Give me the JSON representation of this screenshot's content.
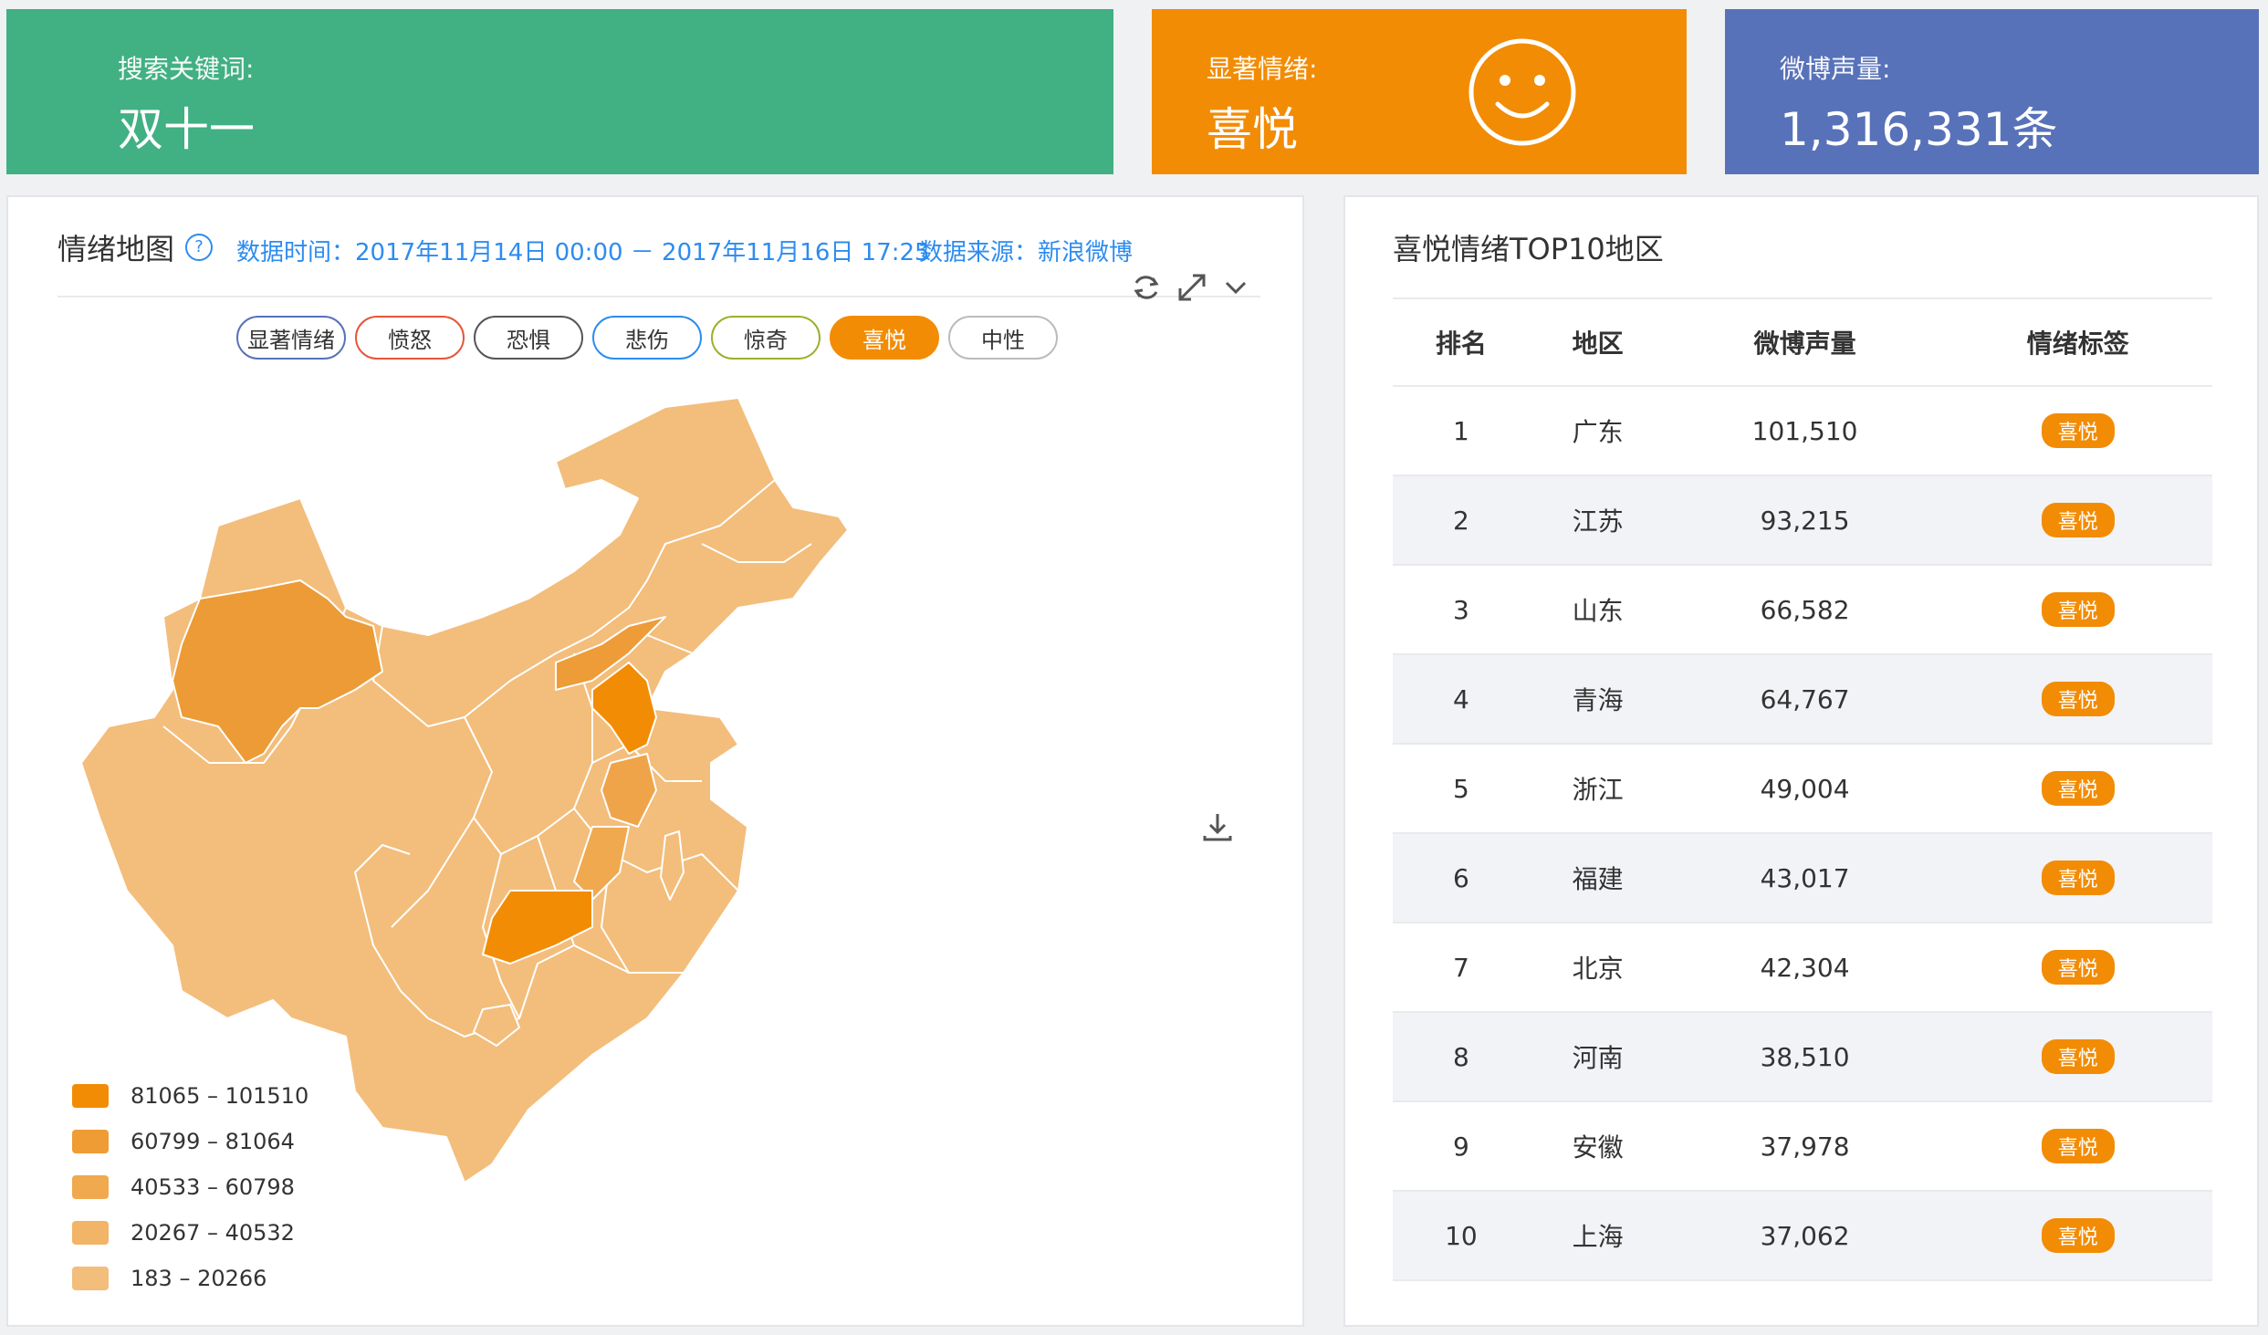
{
  "header": {
    "keyword": {
      "label": "搜索关键词:",
      "value": "双十一"
    },
    "emotion": {
      "label": "显著情绪:",
      "value": "喜悦",
      "icon": "smiley-icon"
    },
    "volume": {
      "label": "微博声量:",
      "value": "1,316,331条"
    }
  },
  "map_panel": {
    "title": "情绪地图",
    "help_icon": "?",
    "data_time": "数据时间：2017年11月14日 00:00 － 2017年11月16日 17:25",
    "data_source": "数据来源：新浪微博",
    "chips": [
      {
        "label": "显著情绪",
        "color": "#5872b9"
      },
      {
        "label": "愤怒",
        "color": "#e8543a"
      },
      {
        "label": "恐惧",
        "color": "#555555"
      },
      {
        "label": "悲伤",
        "color": "#2d8cf0"
      },
      {
        "label": "惊奇",
        "color": "#9bb02b"
      },
      {
        "label": "喜悦",
        "color": "#f28c05",
        "active": true
      },
      {
        "label": "中性",
        "color": "#bbbbbb"
      }
    ],
    "legend": [
      {
        "range": "81065 – 101510",
        "color": "#f28c05"
      },
      {
        "range": "60799 – 81064",
        "color": "#ef9c35"
      },
      {
        "range": "40533 – 60798",
        "color": "#f0a94e"
      },
      {
        "range": "20267 – 40532",
        "color": "#f2b467"
      },
      {
        "range": "183 – 20266",
        "color": "#f3bd7b"
      }
    ]
  },
  "top_panel": {
    "title": "喜悦情绪TOP10地区",
    "columns": [
      "排名",
      "地区",
      "微博声量",
      "情绪标签"
    ],
    "rows": [
      {
        "rank": "1",
        "region": "广东",
        "volume": "101,510",
        "tag": "喜悦"
      },
      {
        "rank": "2",
        "region": "江苏",
        "volume": "93,215",
        "tag": "喜悦"
      },
      {
        "rank": "3",
        "region": "山东",
        "volume": "66,582",
        "tag": "喜悦"
      },
      {
        "rank": "4",
        "region": "青海",
        "volume": "64,767",
        "tag": "喜悦"
      },
      {
        "rank": "5",
        "region": "浙江",
        "volume": "49,004",
        "tag": "喜悦"
      },
      {
        "rank": "6",
        "region": "福建",
        "volume": "43,017",
        "tag": "喜悦"
      },
      {
        "rank": "7",
        "region": "北京",
        "volume": "42,304",
        "tag": "喜悦"
      },
      {
        "rank": "8",
        "region": "河南",
        "volume": "38,510",
        "tag": "喜悦"
      },
      {
        "rank": "9",
        "region": "安徽",
        "volume": "37,978",
        "tag": "喜悦"
      },
      {
        "rank": "10",
        "region": "上海",
        "volume": "37,062",
        "tag": "喜悦"
      }
    ]
  }
}
